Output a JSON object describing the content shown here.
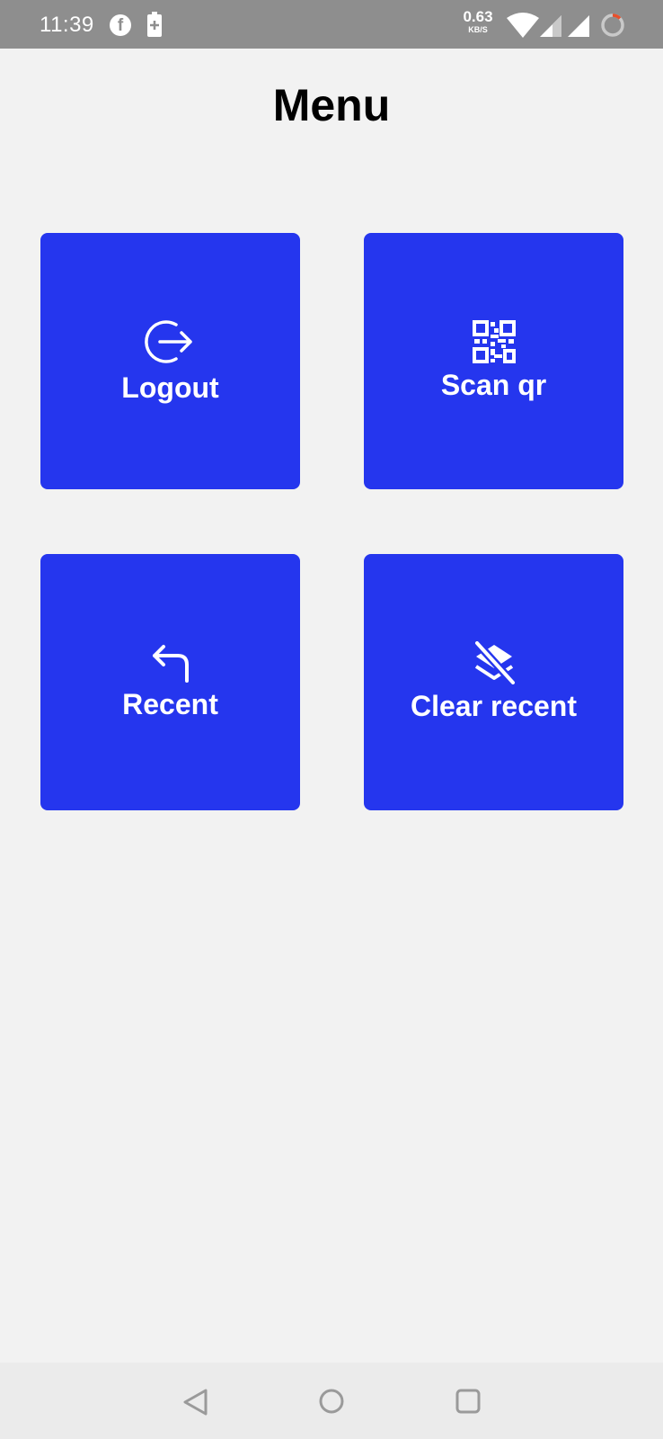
{
  "status_bar": {
    "time": "11:39",
    "net_speed": "0.63",
    "net_unit": "KB/S",
    "icons": [
      "facebook-icon",
      "battery-icon",
      "wifi-icon",
      "signal-icon",
      "signal-icon",
      "sync-icon"
    ]
  },
  "header": {
    "title": "Menu"
  },
  "menu": {
    "accent_color": "#2536ee",
    "items": [
      {
        "label": "Logout",
        "icon": "logout-icon"
      },
      {
        "label": "Scan qr",
        "icon": "qr-code-icon"
      },
      {
        "label": "Recent",
        "icon": "reply-arrow-icon"
      },
      {
        "label": "Clear recent",
        "icon": "layers-clear-icon"
      }
    ]
  },
  "nav_bar": {
    "icons": [
      "back-icon",
      "home-icon",
      "recents-icon"
    ]
  }
}
